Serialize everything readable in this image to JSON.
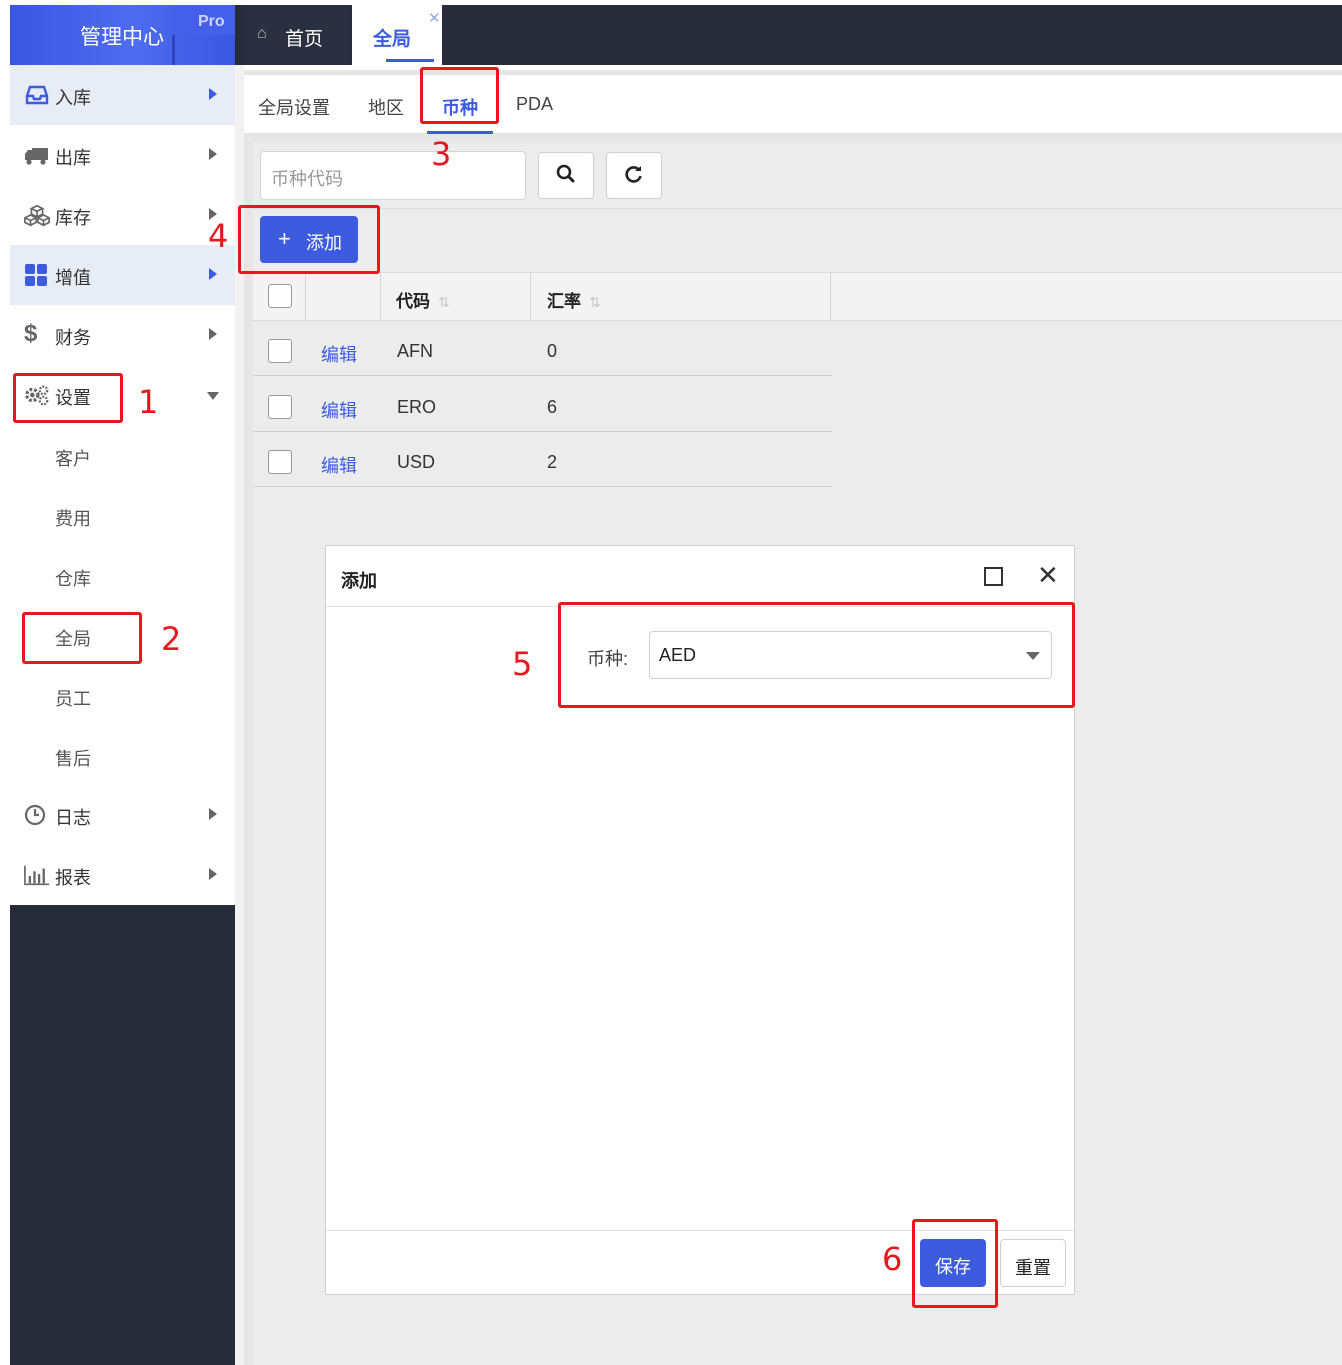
{
  "header": {
    "brand": "管理中心",
    "badge": "Pro",
    "tabs": [
      {
        "label": "首页",
        "icon": "home-icon"
      },
      {
        "label": "全局",
        "icon": "close-icon",
        "active": true
      }
    ]
  },
  "sidebar": {
    "items": [
      {
        "label": "入库",
        "icon": "inbox-icon",
        "highlighted": true
      },
      {
        "label": "出库",
        "icon": "truck-icon"
      },
      {
        "label": "库存",
        "icon": "cubes-icon"
      },
      {
        "label": "增值",
        "icon": "grid-icon",
        "highlighted": true
      },
      {
        "label": "财务",
        "icon": "dollar-icon"
      },
      {
        "label": "设置",
        "icon": "gears-icon",
        "expanded": true
      },
      {
        "label": "日志",
        "icon": "clock-icon"
      },
      {
        "label": "报表",
        "icon": "bar-chart-icon"
      }
    ],
    "settings_children": [
      "客户",
      "费用",
      "仓库",
      "全局",
      "员工",
      "售后"
    ]
  },
  "subtabs": {
    "items": [
      "全局设置",
      "地区",
      "币种",
      "PDA"
    ],
    "active": "币种"
  },
  "toolbar": {
    "search_placeholder": "币种代码",
    "add_label": "添加"
  },
  "table": {
    "columns": [
      "代码",
      "汇率"
    ],
    "sort_icon": "⇅",
    "rows": [
      {
        "action": "编辑",
        "code": "AFN",
        "rate": "0"
      },
      {
        "action": "编辑",
        "code": "ERO",
        "rate": "6"
      },
      {
        "action": "编辑",
        "code": "USD",
        "rate": "2"
      }
    ]
  },
  "dialog": {
    "title": "添加",
    "field_label": "币种:",
    "field_value": "AED",
    "save_label": "保存",
    "reset_label": "重置"
  },
  "annotations": [
    "1",
    "2",
    "3",
    "4",
    "5",
    "6"
  ],
  "colors": {
    "accent": "#3c5bdf",
    "topbar": "#262c3a",
    "annotation": "#e8171e"
  }
}
